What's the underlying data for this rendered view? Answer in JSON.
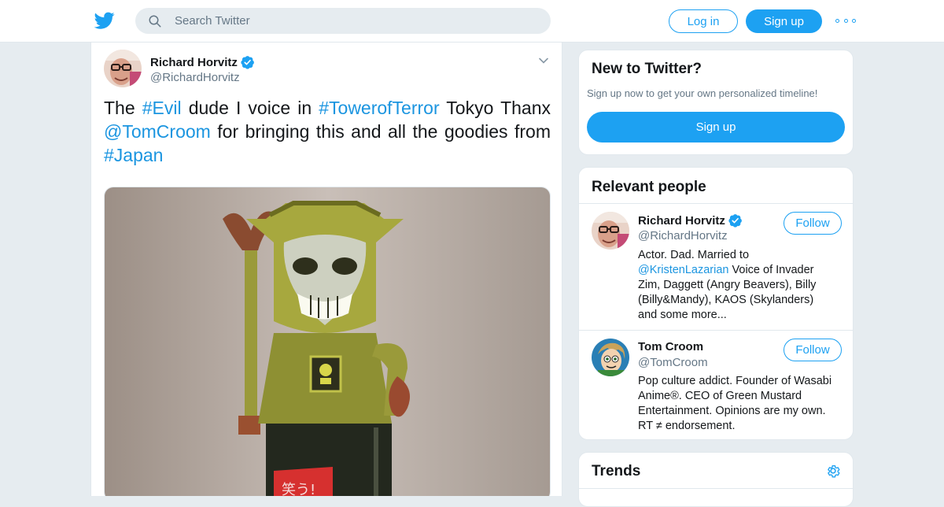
{
  "topbar": {
    "logo_icon": "twitter-bird-icon",
    "search_placeholder": "Search Twitter",
    "login_label": "Log in",
    "signup_label": "Sign up",
    "more_icon": "more-dots-icon",
    "accent_color": "#1da1f2"
  },
  "tweet": {
    "author_name": "Richard Horvitz",
    "author_handle": "@RichardHorvitz",
    "verified": true,
    "text_parts": [
      {
        "type": "text",
        "value": "The "
      },
      {
        "type": "link",
        "value": "#Evil"
      },
      {
        "type": "text",
        "value": " dude I voice in "
      },
      {
        "type": "link",
        "value": "#TowerofTerror"
      },
      {
        "type": "text",
        "value": " Tokyo Thanx "
      },
      {
        "type": "link",
        "value": "@TomCroom"
      },
      {
        "type": "text",
        "value": " for bringing this and all the goodies from "
      },
      {
        "type": "link",
        "value": "#Japan"
      }
    ],
    "media_icon": "tiki-figure-photo"
  },
  "new_to_twitter": {
    "title": "New to Twitter?",
    "subtitle": "Sign up now to get your own personalized timeline!",
    "signup_label": "Sign up"
  },
  "relevant_people": {
    "title": "Relevant people",
    "people": [
      {
        "name": "Richard Horvitz",
        "handle": "@RichardHorvitz",
        "verified": true,
        "follow_label": "Follow",
        "bio_parts": [
          {
            "type": "text",
            "value": "Actor. Dad. Married to "
          },
          {
            "type": "link",
            "value": "@KristenLazarian"
          },
          {
            "type": "text",
            "value": " Voice of Invader Zim, Daggett (Angry Beavers), Billy (Billy&Mandy), KAOS (Skylanders) and some more..."
          }
        ]
      },
      {
        "name": "Tom Croom",
        "handle": "@TomCroom",
        "verified": false,
        "follow_label": "Follow",
        "bio_parts": [
          {
            "type": "text",
            "value": "Pop culture addict. Founder of Wasabi Anime®. CEO of Green Mustard Entertainment. Opinions are my own. RT ≠ endorsement."
          }
        ]
      }
    ]
  },
  "trends": {
    "title": "Trends",
    "settings_icon": "gear-icon"
  }
}
